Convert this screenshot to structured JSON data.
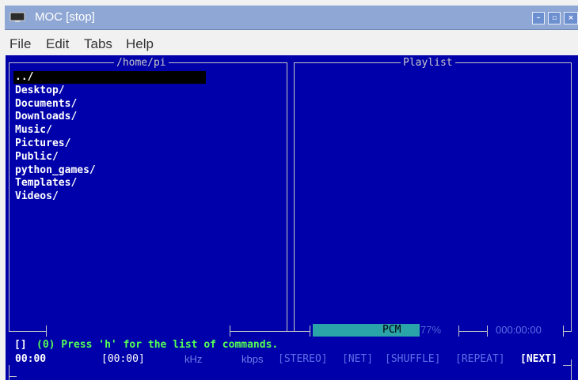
{
  "window": {
    "title": "MOC [stop]",
    "controls": {
      "minimize": "–",
      "maximize": "▫",
      "close": "×"
    }
  },
  "menu": {
    "items": [
      "File",
      "Edit",
      "Tabs",
      "Help"
    ]
  },
  "browser": {
    "path_label": "/home/pi",
    "entries": [
      "../",
      "Desktop/",
      "Documents/",
      "Downloads/",
      "Music/",
      "Pictures/",
      "Public/",
      "python_games/",
      "Templates/",
      "Videos/"
    ],
    "selected_index": 0
  },
  "playlist": {
    "label": "Playlist"
  },
  "mixer": {
    "channel": "PCM",
    "volume_text": "77%",
    "volume_level": 0.77
  },
  "time_total": "000:00:00",
  "status": {
    "message_brackets": "[]",
    "message": "(0) Press 'h' for the list of commands.",
    "current_time": "00:00",
    "duration": "[00:00]",
    "khz": "kHz",
    "kbps": "kbps",
    "flags": [
      "[STEREO]",
      "[NET]",
      "[SHUFFLE]",
      "[REPEAT]",
      "[NEXT]"
    ]
  },
  "colors": {
    "terminal_bg": "#0000aa",
    "frame": "#c8c8c8",
    "message": "#55ff55",
    "flag_off": "#5f6fe8",
    "flag_on": "#ffffff",
    "mixer_bar": "#2aa3a9"
  }
}
